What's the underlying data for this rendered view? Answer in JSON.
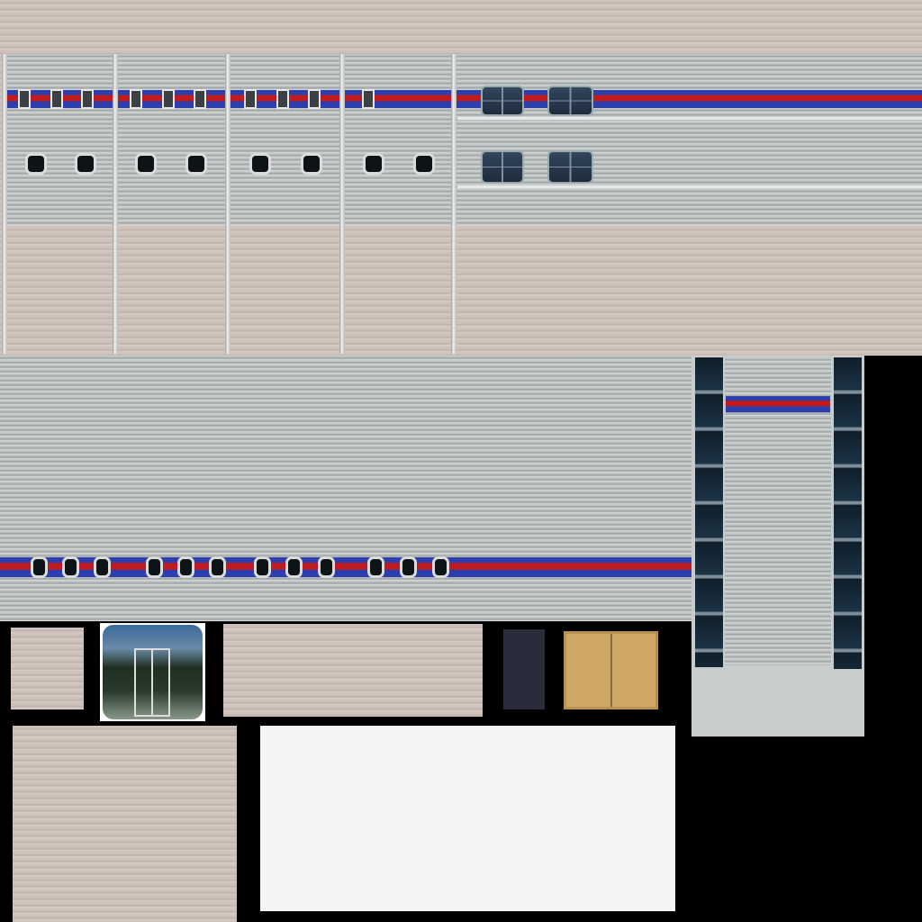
{
  "colors": {
    "siding_beige": "#cfc3bb",
    "siding_gray": "#c9cdcd",
    "stripe_red": "#c01c20",
    "stripe_blue": "#2d3fae",
    "background": "#000000",
    "door_tan": "#cfa865",
    "door_dark": "#2a2c3c",
    "panel_white": "#f4f4f2"
  }
}
